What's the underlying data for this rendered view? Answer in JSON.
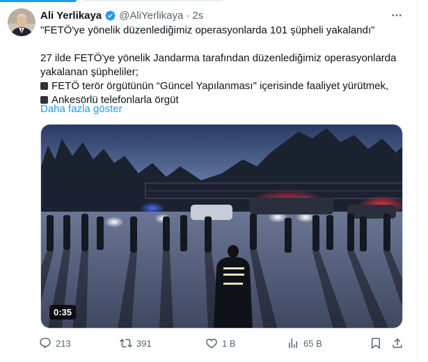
{
  "author": {
    "name": "Ali Yerlikaya",
    "handle": "@AliYerlikaya",
    "separator": "·",
    "time": "2s"
  },
  "tweet": {
    "headline": "\"FETÖ'ye yönelik düzenlediğimiz operasyonlarda 101 şüpheli yakalandı\"",
    "line1": "27 ilde FETÖ'ye yönelik Jandarma tarafından düzenlediğimiz operasyonlarda",
    "line2": "yakalanan şüpheliler;",
    "bullet1": "FETÖ terör örgütünün “Güncel Yapılanması\" içerisinde faaliyet yürütmek,",
    "bullet2": "Ankesörlü telefonlarla örgüt",
    "show_more": "Daha fazla göster"
  },
  "video": {
    "duration": "0:35"
  },
  "actions": {
    "replies": "213",
    "reposts": "391",
    "likes": "1 B",
    "views": "65 B"
  },
  "colors": {
    "accent": "#1d9bf0",
    "verified": "#1d9bf0",
    "muted": "#536471"
  },
  "icons": [
    "verified-badge-icon",
    "more-icon",
    "reply-icon",
    "repost-icon",
    "like-icon",
    "views-icon",
    "bookmark-icon",
    "share-icon"
  ]
}
